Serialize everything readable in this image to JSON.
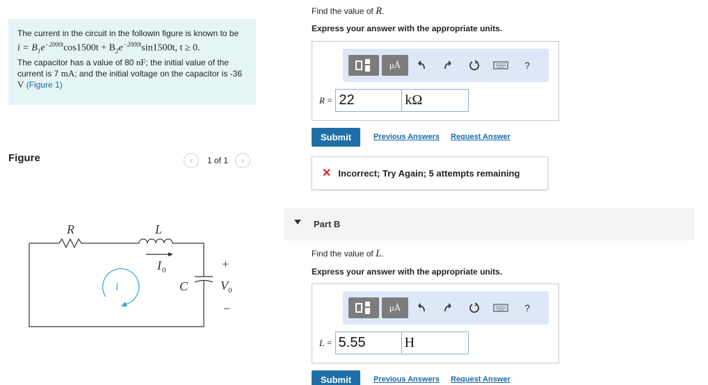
{
  "problem": {
    "intro": "The current in the circuit in the followin figure is known to be",
    "equation_main": "i = B",
    "equation_part2": "cos1500t + B",
    "equation_part3": "sin1500t, t ≥ 0.",
    "exponent": "−2000t",
    "cap_text_1": "The capacitor has a value of 80",
    "cap_unit": "nF",
    "cap_text_2": "; the initial value of the current is 7",
    "current_unit": "mA",
    "cap_text_3": "; and the initial voltage on the capacitor is -36",
    "voltage_unit": "V",
    "figure_link": "(Figure 1)"
  },
  "figure": {
    "label": "Figure",
    "pager": "1 of 1",
    "prev_icon": "‹",
    "next_icon": "›",
    "circuit_labels": {
      "R": "R",
      "L": "L",
      "I0": "I",
      "I0_sub": "0",
      "i": "i",
      "C": "C",
      "V0": "V",
      "V0_sub": "0",
      "plus": "+",
      "minus": "−"
    }
  },
  "part_a": {
    "prompt_prefix": "Find the value of",
    "prompt_var": "R",
    "prompt_suffix": ".",
    "instruction": "Express your answer with the appropriate units.",
    "var_label": "R",
    "equals": "=",
    "value": "22",
    "unit": "kΩ",
    "submit": "Submit",
    "previous_answers": "Previous Answers",
    "request_answer": "Request Answer",
    "feedback_icon": "✕",
    "feedback": "Incorrect; Try Again; 5 attempts remaining"
  },
  "part_b": {
    "title": "Part B",
    "prompt_prefix": "Find the value of",
    "prompt_var": "L",
    "prompt_suffix": ".",
    "instruction": "Express your answer with the appropriate units.",
    "var_label": "L",
    "equals": "=",
    "value": "5.55",
    "unit": "H",
    "submit": "Submit",
    "previous_answers": "Previous Answers",
    "request_answer": "Request Answer"
  },
  "toolbar": {
    "mu_label": "μÅ",
    "help": "?"
  },
  "colors": {
    "problem_bg": "#e5f5f5",
    "link": "#1565a8",
    "submit_bg": "#1f6ea6",
    "toolbar_bg": "#dce8f7",
    "error": "#d8232a"
  }
}
